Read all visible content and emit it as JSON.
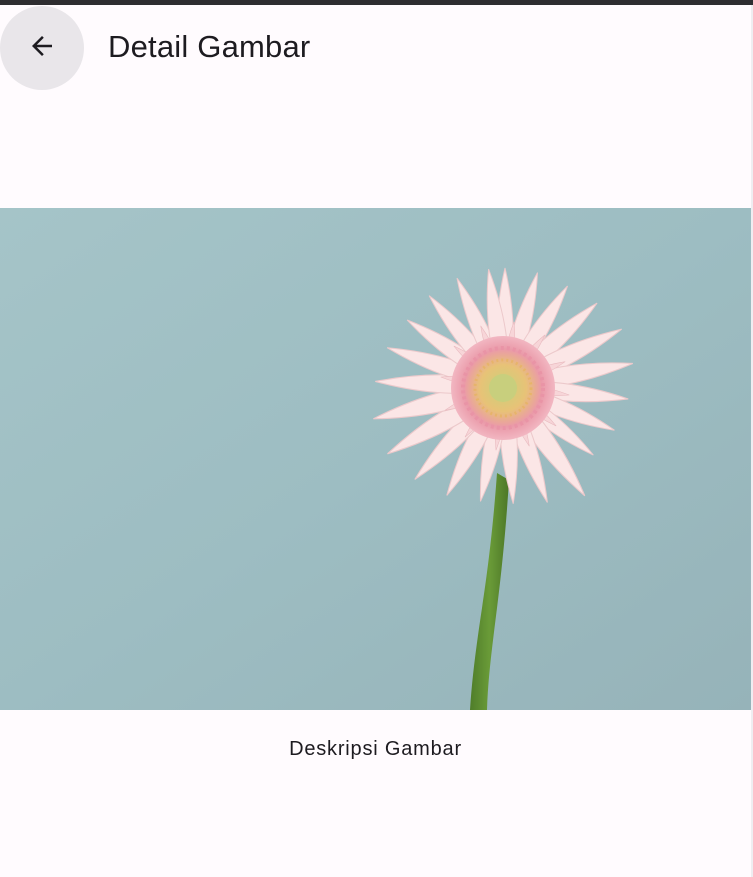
{
  "app_bar": {
    "title": "Detail Gambar",
    "back_icon": "arrow-back-icon"
  },
  "image": {
    "subject": "pink-gerbera-daisy-photo",
    "background_color": "#9fbfc4"
  },
  "caption": {
    "text": "Deskripsi Gambar"
  },
  "colors": {
    "surface": "#fffbfe",
    "on_surface": "#1d1b20",
    "back_button_bg": "#e9e6ea"
  }
}
